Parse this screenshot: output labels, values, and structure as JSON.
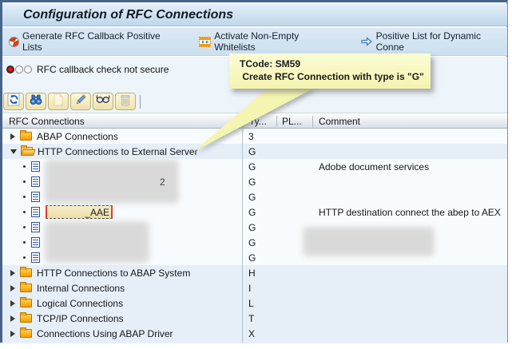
{
  "window": {
    "title": "Configuration of RFC Connections"
  },
  "app_toolbar": {
    "buttons": [
      {
        "name": "generate-rfc-callback-button",
        "icon": "generate-icon",
        "label": "Generate RFC Callback Positive Lists"
      },
      {
        "name": "activate-whitelists-button",
        "icon": "activate-icon",
        "label": "Activate Non-Empty Whitelists"
      },
      {
        "name": "positive-list-dynamic-button",
        "icon": "arrow-right-icon",
        "label": "Positive List for Dynamic Conne"
      }
    ]
  },
  "status": {
    "icon": "traffic-light-icon",
    "text": "RFC callback check not secure"
  },
  "tooltip": {
    "line1": "TCode: SM59",
    "line2": " Create RFC Connection with type is \"G\"",
    "bg_color": "#f8f8c0"
  },
  "icon_toolbar": {
    "buttons": [
      {
        "name": "refresh-button",
        "icon": "refresh-icon",
        "enabled": true
      },
      {
        "name": "find-button",
        "icon": "find-icon",
        "enabled": true
      },
      {
        "name": "create-button",
        "icon": "create-icon",
        "enabled": false
      },
      {
        "name": "edit-button",
        "icon": "edit-icon",
        "enabled": true
      },
      {
        "name": "display-button",
        "icon": "display-icon",
        "enabled": true
      },
      {
        "name": "delete-button",
        "icon": "delete-icon",
        "enabled": false
      }
    ]
  },
  "table": {
    "columns": [
      "RFC Connections",
      "Ty...",
      "PL...",
      "Comment"
    ],
    "rows": [
      {
        "kind": "group",
        "state": "collapsed",
        "label": "ABAP Connections",
        "type": "3",
        "comment": "",
        "shade": "white"
      },
      {
        "kind": "group",
        "state": "expanded",
        "label": "HTTP Connections to External Server",
        "type": "G",
        "comment": "",
        "shade": "blue"
      },
      {
        "kind": "leaf",
        "redacted": true,
        "label": "",
        "type": "G",
        "comment": "Adobe document services",
        "shade": "white"
      },
      {
        "kind": "leaf",
        "redacted": true,
        "label": "",
        "visible_suffix": "2",
        "type": "G",
        "comment": "",
        "shade": "white"
      },
      {
        "kind": "leaf",
        "redacted": true,
        "label": "",
        "type": "G",
        "comment": "",
        "shade": "white"
      },
      {
        "kind": "leaf",
        "redacted": true,
        "selected": true,
        "label": "_AAE",
        "type": "G",
        "comment": "HTTP destination connect the abep to AEX",
        "shade": "white"
      },
      {
        "kind": "leaf",
        "redacted": true,
        "label": "",
        "type": "G",
        "comment": "",
        "shade": "white"
      },
      {
        "kind": "leaf",
        "redacted": true,
        "label": "",
        "type": "G",
        "comment": "",
        "comment_redacted": true,
        "shade": "white"
      },
      {
        "kind": "leaf",
        "redacted": true,
        "label": "",
        "type": "G",
        "comment": "",
        "shade": "white"
      },
      {
        "kind": "group",
        "state": "collapsed",
        "label": "HTTP Connections to ABAP System",
        "type": "H",
        "comment": "",
        "shade": "blue"
      },
      {
        "kind": "group",
        "state": "collapsed",
        "label": "Internal Connections",
        "type": "I",
        "comment": "",
        "shade": "blue"
      },
      {
        "kind": "group",
        "state": "collapsed",
        "label": "Logical Connections",
        "type": "L",
        "comment": "",
        "shade": "blue"
      },
      {
        "kind": "group",
        "state": "collapsed",
        "label": "TCP/IP Connections",
        "type": "T",
        "comment": "",
        "shade": "blue"
      },
      {
        "kind": "group",
        "state": "collapsed",
        "label": "Connections Using ABAP Driver",
        "type": "X",
        "comment": "",
        "shade": "blue"
      }
    ]
  },
  "colors": {
    "frame": "#47648a",
    "titlebar_top": "#e4eff9",
    "titlebar_bottom": "#bed7eb",
    "toolbar_bg": "#d3e2f0",
    "content_bg": "#edf4fa",
    "row_blue": "#e6eff7",
    "row_white": "#f9fcfe",
    "selection_red": "#e23b2e",
    "selection_fill": "#f2e6b8",
    "tooltip_yellow": "#f8f8c0",
    "status_red": "#ee1111",
    "folder_orange": "#f59b00"
  }
}
